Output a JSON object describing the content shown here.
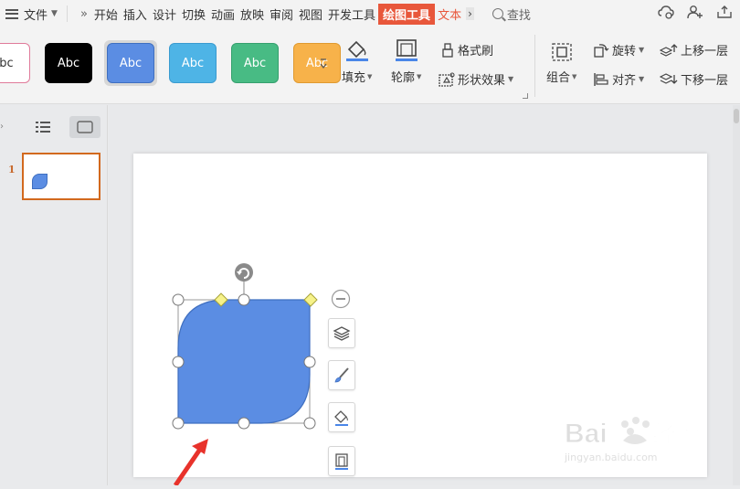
{
  "menubar": {
    "file_label": "文件",
    "tabs": [
      {
        "label": "开始",
        "state": "normal"
      },
      {
        "label": "插入",
        "state": "normal"
      },
      {
        "label": "设计",
        "state": "normal"
      },
      {
        "label": "切换",
        "state": "normal"
      },
      {
        "label": "动画",
        "state": "normal"
      },
      {
        "label": "放映",
        "state": "normal"
      },
      {
        "label": "审阅",
        "state": "normal"
      },
      {
        "label": "视图",
        "state": "normal"
      },
      {
        "label": "开发工具",
        "state": "normal"
      },
      {
        "label": "绘图工具",
        "state": "active"
      },
      {
        "label": "文本",
        "state": "orange"
      }
    ],
    "search_label": "查找"
  },
  "ribbon": {
    "styles": [
      {
        "text": "bc",
        "bg": "#ffffff",
        "fg": "#333333",
        "border": "#e07a9a"
      },
      {
        "text": "Abc",
        "bg": "#000000",
        "fg": "#ffffff",
        "border": "#000000"
      },
      {
        "text": "Abc",
        "bg": "#5b8de3",
        "fg": "#ffffff",
        "border": "#3f6fc0"
      },
      {
        "text": "Abc",
        "bg": "#4eb4e6",
        "fg": "#ffffff",
        "border": "#3a9bd0"
      },
      {
        "text": "Abc",
        "bg": "#48bb84",
        "fg": "#ffffff",
        "border": "#36a06e"
      },
      {
        "text": "Abc",
        "bg": "#f7b24a",
        "fg": "#ffffff",
        "border": "#e09a30"
      }
    ],
    "fill_label": "填充",
    "outline_label": "轮廓",
    "format_painter_label": "格式刷",
    "shape_effects_label": "形状效果",
    "group_label": "组合",
    "rotate_label": "旋转",
    "align_label": "对齐",
    "bring_forward_label": "上移一层",
    "send_backward_label": "下移一层"
  },
  "panel": {
    "slide_number": "1"
  },
  "colors": {
    "accent": "#e8573b",
    "shape_fill": "#5b8de3",
    "shape_stroke": "#3f6fc0",
    "thumb_border": "#d2691e",
    "arrow": "#e8322b"
  },
  "watermark": {
    "brand": "Bai",
    "brand2": "经验",
    "url": "jingyan.baidu.com"
  }
}
